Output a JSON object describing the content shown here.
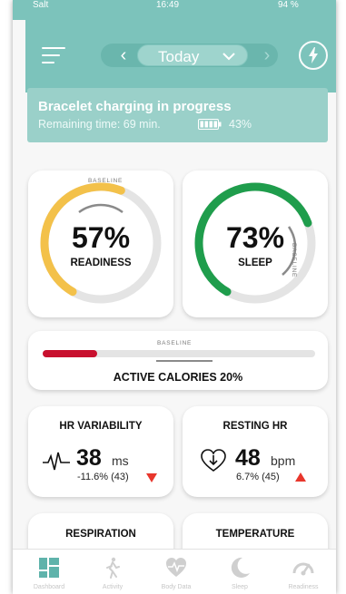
{
  "status_bar": {
    "carrier": "Salt",
    "time": "16:49",
    "battery": "94 %"
  },
  "header": {
    "date_label": "Today"
  },
  "banner": {
    "title": "Bracelet charging in progress",
    "remaining": "Remaining time: 69 min.",
    "battery_percent": "43%"
  },
  "readiness": {
    "value": "57%",
    "label": "READINESS",
    "baseline": "BASELINE",
    "fraction": 0.57
  },
  "sleep": {
    "value": "73%",
    "label": "SLEEP",
    "baseline": "BASELINE",
    "fraction": 0.73
  },
  "active_calories": {
    "label": "ACTIVE CALORIES",
    "value": "20%",
    "baseline": "BASELINE",
    "fraction": 0.2
  },
  "hr_variability": {
    "title": "HR VARIABILITY",
    "value": "38",
    "unit": "ms",
    "change": "-11.6% (43)",
    "direction": "down"
  },
  "resting_hr": {
    "title": "RESTING HR",
    "value": "48",
    "unit": "bpm",
    "change": "6.7% (45)",
    "direction": "up"
  },
  "respiration": {
    "title": "RESPIRATION"
  },
  "temperature": {
    "title": "TEMPERATURE"
  },
  "colors": {
    "accent": "#7cc3bb",
    "readiness": "#f3c14a",
    "sleep": "#1f9d4c",
    "calories": "#c8102e",
    "down": "#e8362c",
    "up": "#e8362c",
    "tab_active": "#5fb3ab",
    "tab_inactive": "#cfcfcf"
  },
  "tabs": [
    {
      "icon": "dashboard-icon",
      "label": "Dashboard",
      "active": true
    },
    {
      "icon": "activity-icon",
      "label": "Activity",
      "active": false
    },
    {
      "icon": "heart-rate-icon",
      "label": "Body Data",
      "active": false
    },
    {
      "icon": "moon-icon",
      "label": "Sleep",
      "active": false
    },
    {
      "icon": "gauge-icon",
      "label": "Readiness",
      "active": false
    }
  ]
}
